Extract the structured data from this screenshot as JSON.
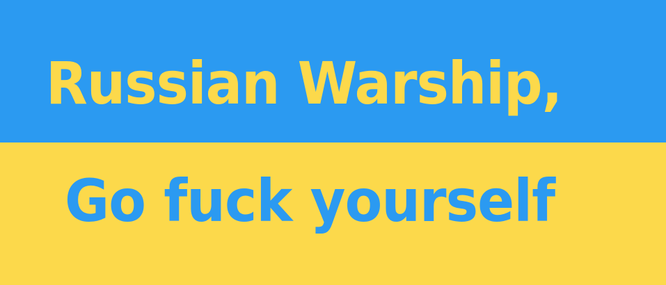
{
  "colors": {
    "blue": "#2b9af1",
    "yellow": "#fcd94b"
  },
  "banner": {
    "line1": "Russian Warship,",
    "line2": "Go fuck yourself"
  }
}
